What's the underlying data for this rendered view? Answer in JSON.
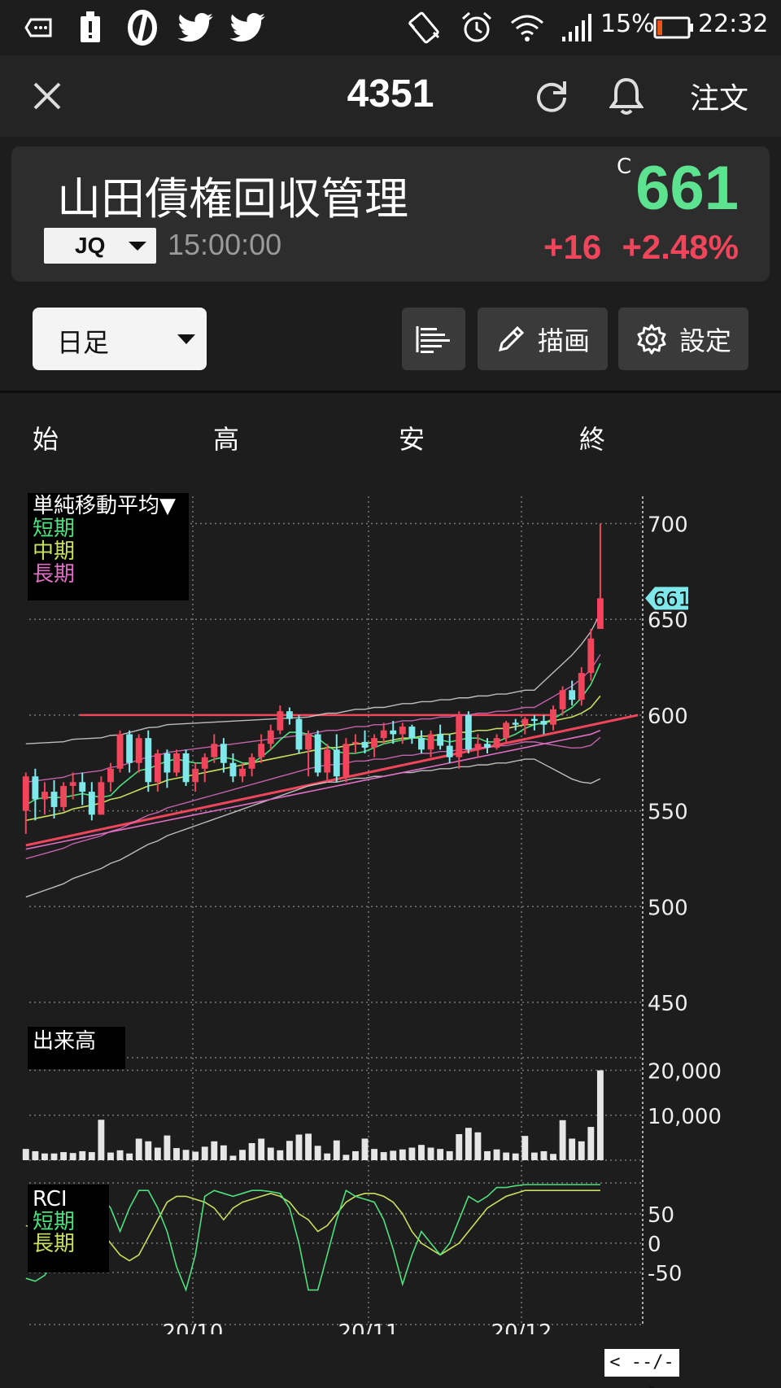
{
  "status_bar": {
    "battery_percent": "15%",
    "time": "22:32",
    "icons": [
      "voicemail-icon",
      "alert-icon",
      "app-icon",
      "twitter-icon",
      "twitter-icon",
      "vibrate-icon",
      "alarm-icon",
      "wifi-icon",
      "signal-icon",
      "battery-icon"
    ]
  },
  "app_bar": {
    "title": "4351",
    "order_label": "注文",
    "icons": [
      "close-icon",
      "refresh-icon",
      "bell-icon"
    ]
  },
  "quote": {
    "name": "山田債権回収管理",
    "market": "JQ",
    "time": "15:00:00",
    "price_mark": "C",
    "price": "661",
    "change": "+16",
    "change_pct": "+2.48%",
    "colors": {
      "up": "#f0455a",
      "price": "#5de28f"
    }
  },
  "toolbar": {
    "period": "日足",
    "draw_label": "描画",
    "settings_label": "設定"
  },
  "ohlc_labels": {
    "open": "始",
    "high": "高",
    "low": "安",
    "close": "終"
  },
  "chart_data": [
    {
      "type": "candlestick",
      "legend_title": "単純移動平均▼",
      "legend": [
        {
          "name": "短期",
          "color": "#4fe07e"
        },
        {
          "name": "中期",
          "color": "#c8e060"
        },
        {
          "name": "長期",
          "color": "#e06ec4"
        }
      ],
      "ylim": [
        450,
        710
      ],
      "yticks": [
        "700",
        "650",
        "600",
        "550",
        "500",
        "450"
      ],
      "current_price_label": "661",
      "horizontal_line": 600,
      "x_labels": [
        "20/10",
        "20/11",
        "20/12"
      ],
      "candles": [
        [
          550,
          570,
          538,
          568
        ],
        [
          568,
          572,
          545,
          556
        ],
        [
          556,
          565,
          548,
          560
        ],
        [
          560,
          566,
          546,
          552
        ],
        [
          552,
          565,
          550,
          563
        ],
        [
          563,
          570,
          556,
          565
        ],
        [
          565,
          570,
          553,
          560
        ],
        [
          560,
          565,
          545,
          548
        ],
        [
          548,
          568,
          548,
          565
        ],
        [
          565,
          575,
          560,
          572
        ],
        [
          572,
          592,
          570,
          590
        ],
        [
          590,
          592,
          570,
          575
        ],
        [
          575,
          590,
          570,
          588
        ],
        [
          588,
          592,
          560,
          565
        ],
        [
          565,
          582,
          560,
          580
        ],
        [
          580,
          582,
          562,
          570
        ],
        [
          570,
          582,
          568,
          580
        ],
        [
          580,
          582,
          563,
          565
        ],
        [
          565,
          575,
          560,
          572
        ],
        [
          572,
          580,
          565,
          578
        ],
        [
          578,
          590,
          575,
          585
        ],
        [
          585,
          588,
          570,
          575
        ],
        [
          575,
          580,
          565,
          568
        ],
        [
          568,
          575,
          565,
          572
        ],
        [
          572,
          580,
          568,
          578
        ],
        [
          578,
          590,
          575,
          585
        ],
        [
          585,
          595,
          582,
          592
        ],
        [
          592,
          605,
          590,
          602
        ],
        [
          602,
          604,
          595,
          598
        ],
        [
          598,
          600,
          580,
          582
        ],
        [
          582,
          592,
          568,
          590
        ],
        [
          590,
          592,
          568,
          570
        ],
        [
          570,
          585,
          565,
          582
        ],
        [
          582,
          590,
          565,
          568
        ],
        [
          568,
          588,
          565,
          585
        ],
        [
          585,
          590,
          580,
          586
        ],
        [
          586,
          592,
          580,
          583
        ],
        [
          583,
          590,
          578,
          588
        ],
        [
          588,
          596,
          585,
          592
        ],
        [
          592,
          597,
          585,
          590
        ],
        [
          590,
          596,
          585,
          594
        ],
        [
          594,
          595,
          585,
          588
        ],
        [
          588,
          592,
          580,
          582
        ],
        [
          582,
          592,
          578,
          590
        ],
        [
          590,
          595,
          582,
          584
        ],
        [
          584,
          590,
          575,
          578
        ],
        [
          578,
          602,
          572,
          600
        ],
        [
          600,
          602,
          580,
          582
        ],
        [
          582,
          590,
          578,
          585
        ],
        [
          585,
          588,
          580,
          583
        ],
        [
          583,
          590,
          582,
          588
        ],
        [
          588,
          597,
          585,
          596
        ],
        [
          596,
          598,
          592,
          595
        ],
        [
          595,
          599,
          590,
          598
        ],
        [
          598,
          600,
          592,
          597
        ],
        [
          597,
          600,
          590,
          595
        ],
        [
          595,
          605,
          592,
          603
        ],
        [
          603,
          615,
          600,
          613
        ],
        [
          613,
          618,
          605,
          608
        ],
        [
          608,
          625,
          605,
          622
        ],
        [
          622,
          645,
          618,
          640
        ],
        [
          645,
          700,
          645,
          661
        ]
      ],
      "ma_short": [
        553,
        556,
        557,
        557,
        557,
        558,
        559,
        558,
        557,
        558,
        563,
        567,
        571,
        572,
        574,
        576,
        577,
        576,
        575,
        575,
        577,
        578,
        577,
        575,
        575,
        578,
        582,
        587,
        591,
        591,
        590,
        588,
        584,
        581,
        580,
        580,
        581,
        583,
        585,
        586,
        587,
        588,
        588,
        587,
        587,
        586,
        587,
        588,
        588,
        586,
        586,
        588,
        590,
        593,
        595,
        596,
        598,
        601,
        604,
        609,
        616,
        627
      ],
      "ma_mid": [
        545,
        546,
        547,
        548,
        549,
        551,
        552,
        553,
        554,
        556,
        557,
        559,
        561,
        563,
        564,
        566,
        567,
        568,
        569,
        570,
        571,
        572,
        573,
        574,
        575,
        576,
        577,
        578,
        579,
        580,
        581,
        582,
        583,
        583,
        584,
        585,
        585,
        586,
        586,
        587,
        588,
        588,
        589,
        589,
        590,
        590,
        591,
        591,
        592,
        592,
        593,
        593,
        594,
        595,
        595,
        596,
        597,
        598,
        599,
        601,
        604,
        610
      ],
      "ma_long": [
        530,
        531,
        532,
        533,
        534,
        535,
        536,
        537,
        538,
        539,
        540,
        541,
        542,
        543,
        544,
        545,
        546,
        547,
        548,
        549,
        550,
        551,
        552,
        553,
        554,
        555,
        556,
        557,
        558,
        559,
        560,
        561,
        562,
        563,
        564,
        565,
        566,
        567,
        568,
        569,
        570,
        571,
        572,
        573,
        574,
        575,
        576,
        577,
        578,
        579,
        580,
        581,
        582,
        583,
        584,
        585,
        586,
        587,
        588,
        589,
        590,
        592
      ],
      "trend_line": {
        "from": [
          0,
          532
        ],
        "to": [
          65,
          600
        ]
      }
    },
    {
      "type": "bar",
      "title": "出来高",
      "yticks": [
        "20,000",
        "10,000"
      ],
      "ylim": [
        0,
        21000
      ],
      "values": [
        2500,
        2000,
        1500,
        1500,
        1800,
        1600,
        2000,
        1800,
        9000,
        1700,
        2200,
        1500,
        4800,
        4200,
        2800,
        5500,
        2700,
        2300,
        1900,
        3000,
        4200,
        3300,
        1000,
        2300,
        3800,
        4800,
        2800,
        2200,
        4300,
        5700,
        5900,
        3200,
        1500,
        4400,
        1200,
        2000,
        4800,
        2500,
        1800,
        2100,
        2400,
        2800,
        3400,
        2800,
        2500,
        2000,
        5800,
        7200,
        6200,
        2000,
        2400,
        1700,
        1500,
        5400,
        1700,
        2000,
        1400,
        8900,
        4800,
        4200,
        7400,
        20000
      ]
    },
    {
      "type": "line",
      "title": "RCI",
      "legend": [
        {
          "name": "短期",
          "color": "#4fe07e"
        },
        {
          "name": "長期",
          "color": "#c8e060"
        }
      ],
      "yticks": [
        "50",
        "0",
        "-50"
      ],
      "ylim": [
        -100,
        100
      ],
      "short": [
        -60,
        -65,
        -55,
        -30,
        20,
        60,
        -20,
        60,
        80,
        60,
        20,
        60,
        90,
        90,
        60,
        20,
        -40,
        -80,
        -20,
        80,
        90,
        85,
        80,
        85,
        90,
        90,
        88,
        85,
        60,
        0,
        -80,
        -80,
        -20,
        40,
        90,
        80,
        75,
        70,
        40,
        -10,
        -70,
        -20,
        20,
        0,
        -20,
        0,
        40,
        80,
        70,
        80,
        95,
        95,
        98,
        100,
        100,
        100,
        100,
        100,
        100,
        100,
        100,
        100
      ],
      "long": [
        30,
        25,
        20,
        30,
        40,
        60,
        50,
        30,
        20,
        0,
        -20,
        -30,
        -20,
        10,
        40,
        70,
        80,
        80,
        75,
        70,
        60,
        40,
        60,
        70,
        75,
        80,
        85,
        80,
        70,
        50,
        40,
        20,
        30,
        50,
        70,
        80,
        85,
        85,
        80,
        70,
        50,
        20,
        0,
        -10,
        -20,
        -10,
        0,
        20,
        40,
        60,
        70,
        80,
        85,
        90,
        90,
        90,
        90,
        90,
        90,
        90,
        90,
        90
      ]
    }
  ],
  "pager_label": "< --/-- >"
}
